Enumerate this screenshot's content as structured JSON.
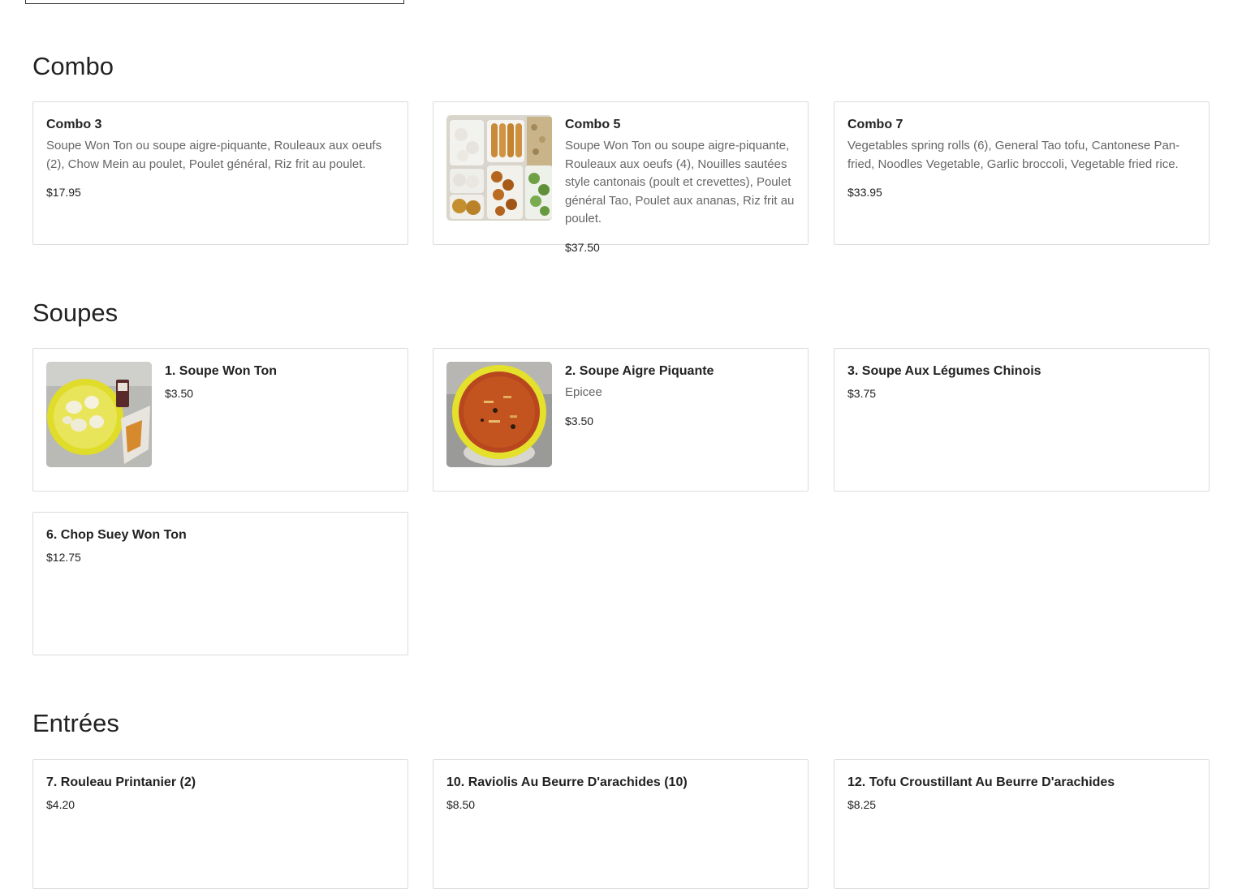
{
  "sections": [
    {
      "title": "Combo"
    },
    {
      "title": "Soupes"
    },
    {
      "title": "Entrées"
    }
  ],
  "combo": [
    {
      "name": "Combo 3",
      "description": "Soupe Won Ton ou soupe aigre-piquante, Rouleaux aux oeufs (2), Chow Mein au poulet, Poulet général, Riz frit au poulet.",
      "price": "$17.95"
    },
    {
      "name": "Combo 5",
      "description": "Soupe Won Ton ou soupe aigre-piquante, Rouleaux aux oeufs (4), Nouilles sautées style cantonais (poult et crevettes), Poulet général Tao, Poulet aux ananas, Riz frit au poulet.",
      "price": "$37.50",
      "image": "combo-platter-photo"
    },
    {
      "name": "Combo 7",
      "description": "Vegetables spring rolls (6), General Tao tofu, Cantonese Pan-fried, Noodles Vegetable, Garlic broccoli, Vegetable fried rice.",
      "price": "$33.95"
    }
  ],
  "soupes": [
    {
      "name": "1. Soupe Won Ton",
      "price": "$3.50",
      "image": "won-ton-soup-photo"
    },
    {
      "name": "2. Soupe Aigre Piquante",
      "description": "Epicee",
      "price": "$3.50",
      "image": "hot-sour-soup-photo"
    },
    {
      "name": "3. Soupe Aux Légumes Chinois",
      "price": "$3.75"
    },
    {
      "name": "6. Chop Suey Won Ton",
      "price": "$12.75"
    }
  ],
  "entrees": [
    {
      "name": "7. Rouleau Printanier (2)",
      "price": "$4.20"
    },
    {
      "name": "10. Raviolis Au Beurre D'arachides (10)",
      "price": "$8.50"
    },
    {
      "name": "12. Tofu Croustillant Au Beurre D'arachides",
      "price": "$8.25"
    }
  ]
}
